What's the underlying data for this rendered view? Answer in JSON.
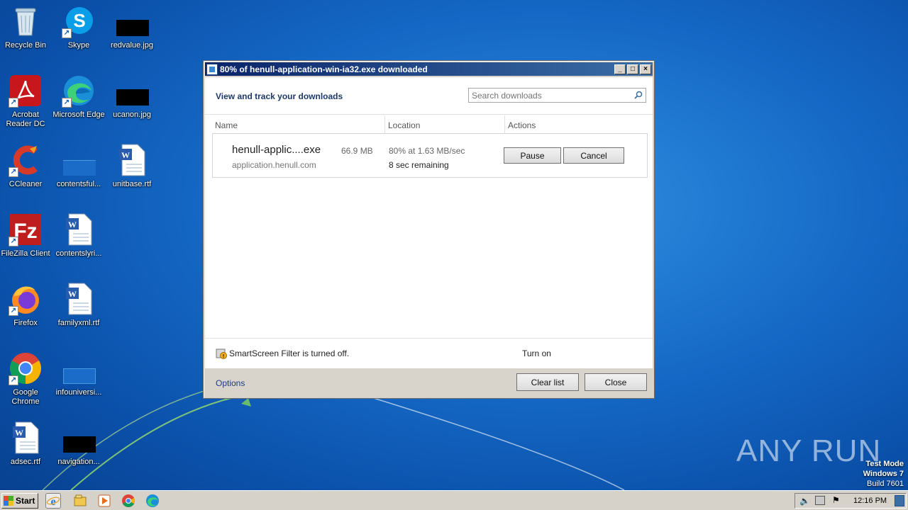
{
  "desktop": {
    "icons": [
      {
        "label": "Recycle Bin"
      },
      {
        "label": "Skype"
      },
      {
        "label": "redvalue.jpg"
      },
      {
        "label": "Acrobat Reader DC"
      },
      {
        "label": "Microsoft Edge"
      },
      {
        "label": "ucanon.jpg"
      },
      {
        "label": "CCleaner"
      },
      {
        "label": "contentsful..."
      },
      {
        "label": "unitbase.rtf"
      },
      {
        "label": "FileZilla Client"
      },
      {
        "label": "contentslyri..."
      },
      {
        "label": "Firefox"
      },
      {
        "label": "familyxml.rtf"
      },
      {
        "label": "Google Chrome"
      },
      {
        "label": "infouniversi..."
      },
      {
        "label": "adsec.rtf"
      },
      {
        "label": "navigation..."
      }
    ]
  },
  "dialog": {
    "title": "80% of henull-application-win-ia32.exe downloaded",
    "header": "View and track your downloads",
    "search_placeholder": "Search downloads",
    "columns": [
      "Name",
      "Location",
      "Actions"
    ],
    "download": {
      "name": "henull-applic....exe",
      "size": "66.9 MB",
      "source": "application.henull.com",
      "progress_text": "80% at 1.63 MB/sec",
      "remaining": "8 sec remaining",
      "progress_fraction": 0.8
    },
    "pause_label": "Pause",
    "cancel_label": "Cancel",
    "smartscreen_text": "SmartScreen Filter is turned off.",
    "turn_on_label": "Turn on",
    "options_label": "Options",
    "clear_list_label": "Clear list",
    "close_label": "Close"
  },
  "taskbar": {
    "start_label": "Start",
    "clock": "12:16 PM"
  },
  "watermark": {
    "text": "ANY RUN",
    "test_mode": "Test Mode",
    "os": "Windows 7",
    "build": "Build 7601"
  },
  "colors": {
    "accent": "#0a246a",
    "desktop": "#1467c4"
  }
}
